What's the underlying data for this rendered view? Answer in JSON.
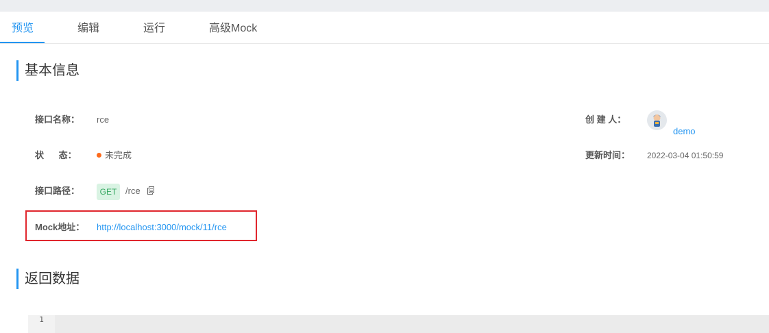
{
  "tabs": [
    {
      "label": "预览",
      "active": true
    },
    {
      "label": "编辑",
      "active": false
    },
    {
      "label": "运行",
      "active": false
    },
    {
      "label": "高级Mock",
      "active": false
    }
  ],
  "basic_info": {
    "title": "基本信息",
    "name_label": "接口名称：",
    "name_value": "rce",
    "status_label": "状      态：",
    "status_value": "未完成",
    "path_label": "接口路径：",
    "method": "GET",
    "path_value": "/rce",
    "mock_label": "Mock地址：",
    "mock_value": "http://localhost:3000/mock/11/rce",
    "creator_label": "创 建 人：",
    "creator_value": "demo",
    "updated_label": "更新时间：",
    "updated_value": "2022-03-04 01:50:59"
  },
  "response": {
    "title": "返回数据",
    "line_number": "1"
  },
  "colors": {
    "accent": "#2395f1",
    "status_dot": "#fd6a1b",
    "highlight_box": "#e0262d",
    "method_bg": "#d9f3e3",
    "method_text": "#33a65f"
  },
  "icons": [
    "copy-icon",
    "avatar-icon",
    "status-dot-icon"
  ]
}
